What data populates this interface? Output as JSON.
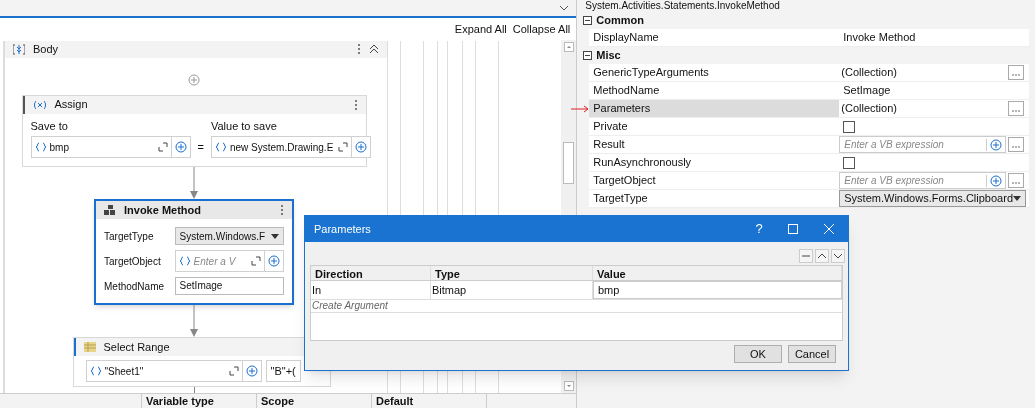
{
  "designer": {
    "toolbar": [
      "Expand All",
      "Collapse All"
    ],
    "body": {
      "title": "Body"
    },
    "activities": [
      {
        "kind": "assign",
        "title": "Assign",
        "selected": false,
        "left_label": "Save to",
        "left_value": "bmp",
        "operator": "=",
        "right_label": "Value to save",
        "right_value": "new System.Drawing.E"
      },
      {
        "kind": "invoke",
        "title": "Invoke Method",
        "selected": true,
        "fields": [
          {
            "kind": "dropdown",
            "label": "TargetType",
            "value": "System.Windows.F"
          },
          {
            "kind": "expression",
            "label": "TargetObject",
            "placeholder": "Enter a V"
          },
          {
            "kind": "text",
            "label": "MethodName",
            "value": "SetImage"
          }
        ]
      },
      {
        "kind": "select_range",
        "title": "Select Range",
        "selected": false,
        "values": [
          "\"Sheet1\"",
          "\"B\"+("
        ]
      }
    ],
    "variables_columns": [
      "Variable type",
      "Scope",
      "Default"
    ]
  },
  "properties": {
    "type_name": "System.Activities.Statements.InvokeMethod",
    "categories": [
      {
        "name": "Common",
        "expanded": true,
        "rows": [
          {
            "kind": "text",
            "name": "DisplayName",
            "value": "Invoke Method",
            "selected": false,
            "arrow": false
          }
        ]
      },
      {
        "name": "Misc",
        "expanded": true,
        "rows": [
          {
            "kind": "collection",
            "name": "GenericTypeArguments",
            "value": "(Collection)",
            "selected": false,
            "arrow": false
          },
          {
            "kind": "text",
            "name": "MethodName",
            "value": "SetImage",
            "selected": false,
            "arrow": false
          },
          {
            "kind": "collection",
            "name": "Parameters",
            "value": "(Collection)",
            "selected": true,
            "arrow": true
          },
          {
            "kind": "checkbox",
            "name": "Private",
            "checked": false,
            "selected": false,
            "arrow": false
          },
          {
            "kind": "expression",
            "name": "Result",
            "placeholder": "Enter a VB expression",
            "selected": false,
            "arrow": false
          },
          {
            "kind": "checkbox",
            "name": "RunAsynchronously",
            "checked": false,
            "selected": false,
            "arrow": false
          },
          {
            "kind": "expression",
            "name": "TargetObject",
            "placeholder": "Enter a VB expression",
            "selected": false,
            "arrow": false
          },
          {
            "kind": "dropdown",
            "name": "TargetType",
            "value": "System.Windows.Forms.Clipboard",
            "selected": false,
            "arrow": false
          }
        ]
      }
    ]
  },
  "dialog": {
    "title": "Parameters",
    "help": "?",
    "columns": [
      "Direction",
      "Type",
      "Value"
    ],
    "rows": [
      {
        "cells": [
          "In",
          "Bitmap",
          "bmp"
        ]
      }
    ],
    "create_placeholder": "Create Argument",
    "buttons": [
      "OK",
      "Cancel"
    ]
  }
}
